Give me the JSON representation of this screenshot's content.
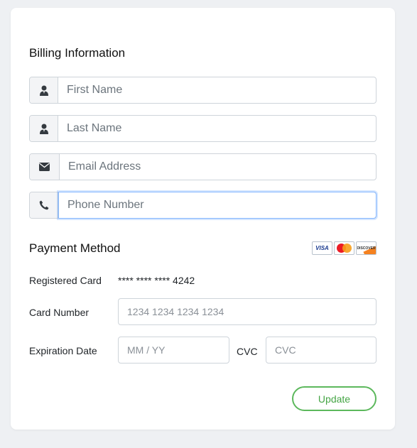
{
  "billing": {
    "title": "Billing Information",
    "fields": [
      {
        "icon": "user-icon",
        "placeholder": "First Name",
        "value": ""
      },
      {
        "icon": "user-icon",
        "placeholder": "Last Name",
        "value": ""
      },
      {
        "icon": "envelope-icon",
        "placeholder": "Email Address",
        "value": ""
      },
      {
        "icon": "phone-icon",
        "placeholder": "Phone Number",
        "value": ""
      }
    ]
  },
  "payment": {
    "title": "Payment Method",
    "logos": [
      "VISA",
      "MasterCard",
      "DISCOVER"
    ],
    "registered_label": "Registered Card",
    "registered_value": "**** **** **** 4242",
    "card_number_label": "Card Number",
    "card_number_placeholder": "1234 1234 1234 1234",
    "expiration_label": "Expiration Date",
    "expiration_placeholder": "MM / YY",
    "cvc_label": "CVC",
    "cvc_placeholder": "CVC",
    "update_label": "Update"
  },
  "colors": {
    "accent": "#5cb85c",
    "focus": "#86b7fe"
  }
}
